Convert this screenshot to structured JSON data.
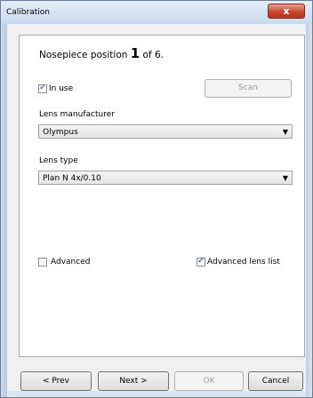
{
  "window": {
    "title": "Calibration",
    "close_glyph": "x"
  },
  "nosepiece": {
    "prefix": "Nosepiece position",
    "number": "1",
    "suffix": "of 6."
  },
  "in_use": {
    "label": "In use",
    "checked": true
  },
  "scan_button": {
    "label": "Scan",
    "enabled": false
  },
  "lens_manufacturer": {
    "label": "Lens manufacturer",
    "value": "Olympus"
  },
  "lens_type": {
    "label": "Lens type",
    "value": "Plan N 4x/0.10"
  },
  "advanced": {
    "label": "Advanced",
    "checked": false
  },
  "advanced_lens_list": {
    "label": "Advanced lens list",
    "checked": true
  },
  "footer": {
    "prev": "< Prev",
    "next": "Next >",
    "ok": "OK",
    "cancel": "Cancel"
  },
  "icons": {
    "close": "close-icon",
    "dropdown": "chevron-down-icon",
    "check": "checkmark-icon"
  }
}
